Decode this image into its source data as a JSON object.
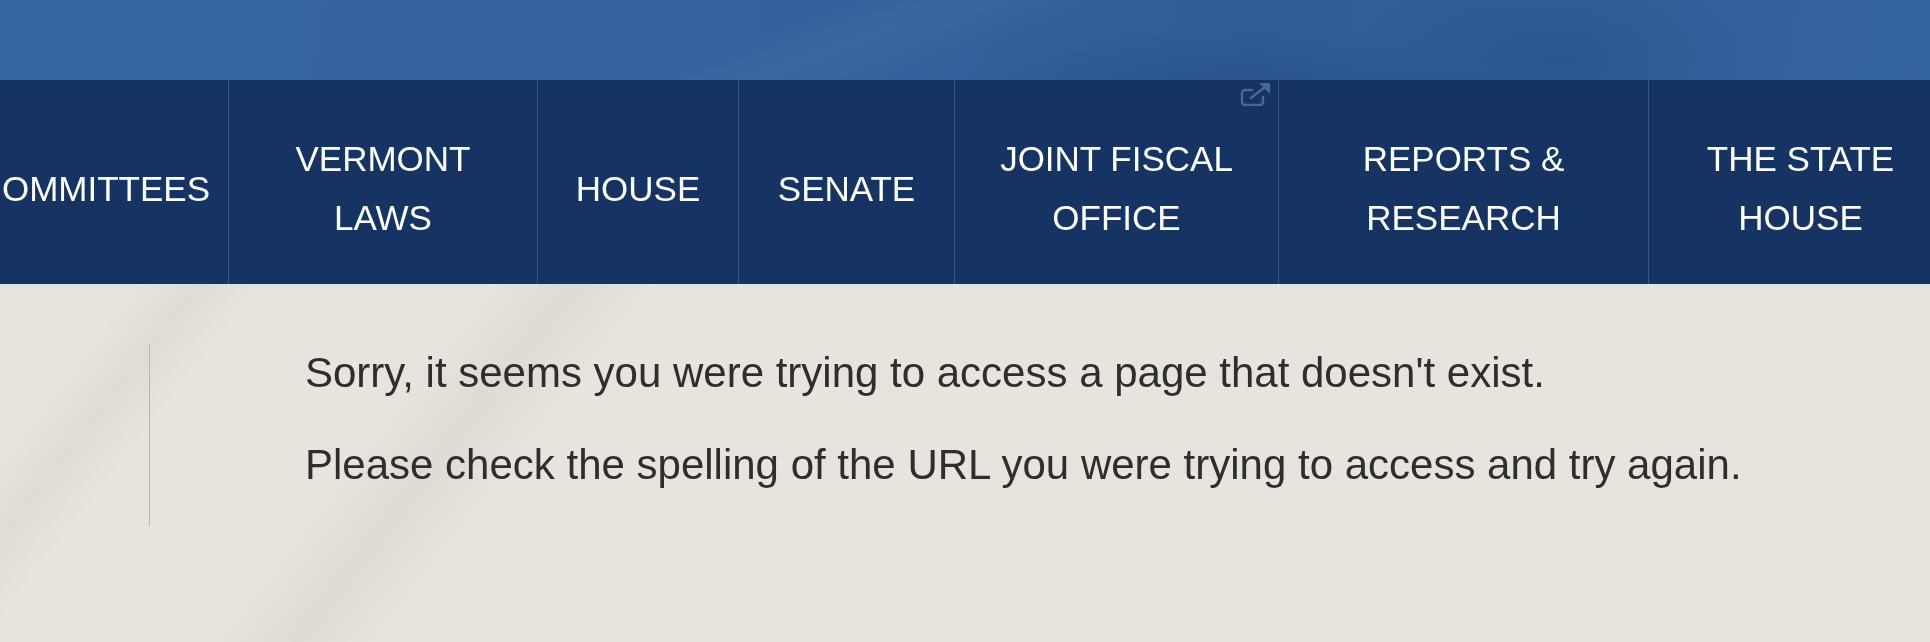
{
  "nav": {
    "items": [
      {
        "label": "OMMITTEES",
        "external": false
      },
      {
        "label": "VERMONT LAWS",
        "external": false
      },
      {
        "label": "HOUSE",
        "external": false
      },
      {
        "label": "SENATE",
        "external": false
      },
      {
        "label": "JOINT FISCAL OFFICE",
        "external": true
      },
      {
        "label": "REPORTS & RESEARCH",
        "external": false
      },
      {
        "label": "THE STATE HOUSE",
        "external": false
      }
    ]
  },
  "message": {
    "paragraphs": [
      "Sorry, it seems you were trying to access a page that doesn't exist.",
      "Please check the spelling of the URL you were trying to access and try again."
    ]
  }
}
